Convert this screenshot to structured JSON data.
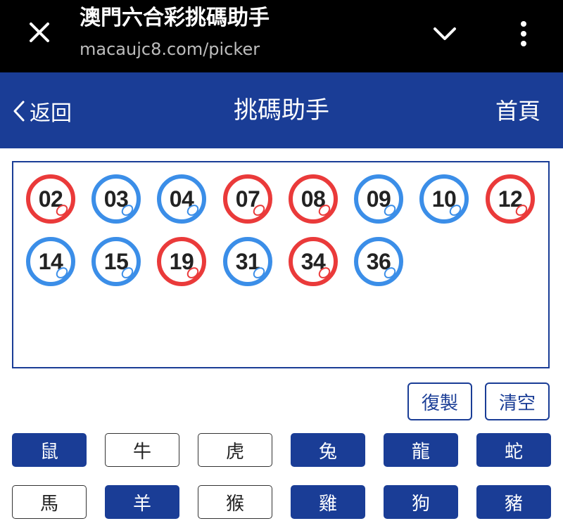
{
  "browser": {
    "title": "澳門六合彩挑碼助手",
    "url": "macaujc8.com/picker",
    "icons": [
      "close-icon",
      "chevron-down-icon",
      "more-vertical-icon"
    ]
  },
  "navbar": {
    "back_label": "返回",
    "title": "挑碼助手",
    "home_label": "首頁",
    "color": "#1a3d96"
  },
  "selected_numbers": [
    {
      "num": "02",
      "color": "red"
    },
    {
      "num": "03",
      "color": "blue"
    },
    {
      "num": "04",
      "color": "blue"
    },
    {
      "num": "07",
      "color": "red"
    },
    {
      "num": "08",
      "color": "red"
    },
    {
      "num": "09",
      "color": "blue"
    },
    {
      "num": "10",
      "color": "blue"
    },
    {
      "num": "12",
      "color": "red"
    },
    {
      "num": "14",
      "color": "blue"
    },
    {
      "num": "15",
      "color": "blue"
    },
    {
      "num": "19",
      "color": "red"
    },
    {
      "num": "31",
      "color": "blue"
    },
    {
      "num": "34",
      "color": "red"
    },
    {
      "num": "36",
      "color": "blue"
    }
  ],
  "ball_colors": {
    "red": "#ea3a3a",
    "blue": "#3b8ee8"
  },
  "actions": {
    "copy_label": "復製",
    "clear_label": "清空"
  },
  "zodiac": [
    {
      "label": "鼠",
      "selected": true
    },
    {
      "label": "牛",
      "selected": false
    },
    {
      "label": "虎",
      "selected": false
    },
    {
      "label": "兔",
      "selected": true
    },
    {
      "label": "龍",
      "selected": true
    },
    {
      "label": "蛇",
      "selected": true
    },
    {
      "label": "馬",
      "selected": false
    },
    {
      "label": "羊",
      "selected": true
    },
    {
      "label": "猴",
      "selected": false
    },
    {
      "label": "雞",
      "selected": true
    },
    {
      "label": "狗",
      "selected": true
    },
    {
      "label": "豬",
      "selected": true
    }
  ]
}
